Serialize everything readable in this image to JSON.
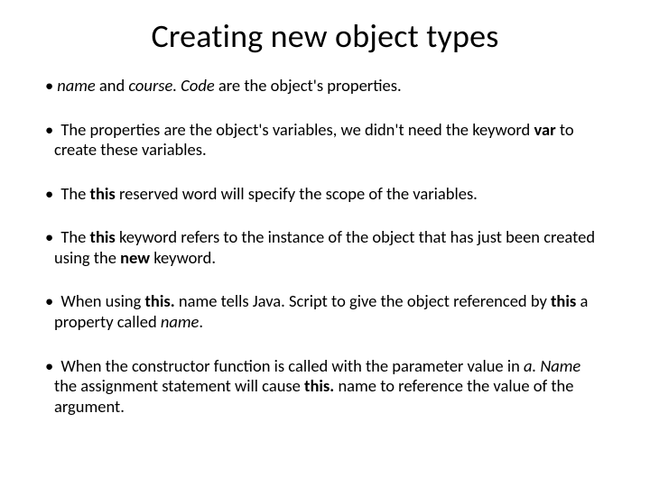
{
  "title": "Creating new object types",
  "b1": {
    "dot": "•",
    "t1": "name",
    "t2": " and ",
    "t3": "course. Code ",
    "t4": "are the object's properties."
  },
  "b2": {
    "dot": "•",
    "t1": " The properties are the object's variables, we didn't need the keyword ",
    "t2": "var",
    "t3": " to create these variables."
  },
  "b3": {
    "dot": "•",
    "t1": " The ",
    "t2": "this",
    "t3": " reserved word will specify the scope of the variables."
  },
  "b4": {
    "dot": "•",
    "t1": " The ",
    "t2": "this",
    "t3": " keyword refers to the instance of the object that has just been created using the ",
    "t4": "new",
    "t5": " keyword."
  },
  "b5": {
    "dot": "•",
    "t1": " When using ",
    "t2": "this.",
    "t3": " name tells Java. Script to give the object referenced by ",
    "t4": "this",
    "t5": " a property called ",
    "t6": "name",
    "t7": "."
  },
  "b6": {
    "dot": "•",
    "t1": " When the constructor function is called with the parameter value in ",
    "t2": "a. Name ",
    "t3": "the assignment statement will cause ",
    "t4": "this.",
    "t5": " name to reference the value of the argument."
  }
}
